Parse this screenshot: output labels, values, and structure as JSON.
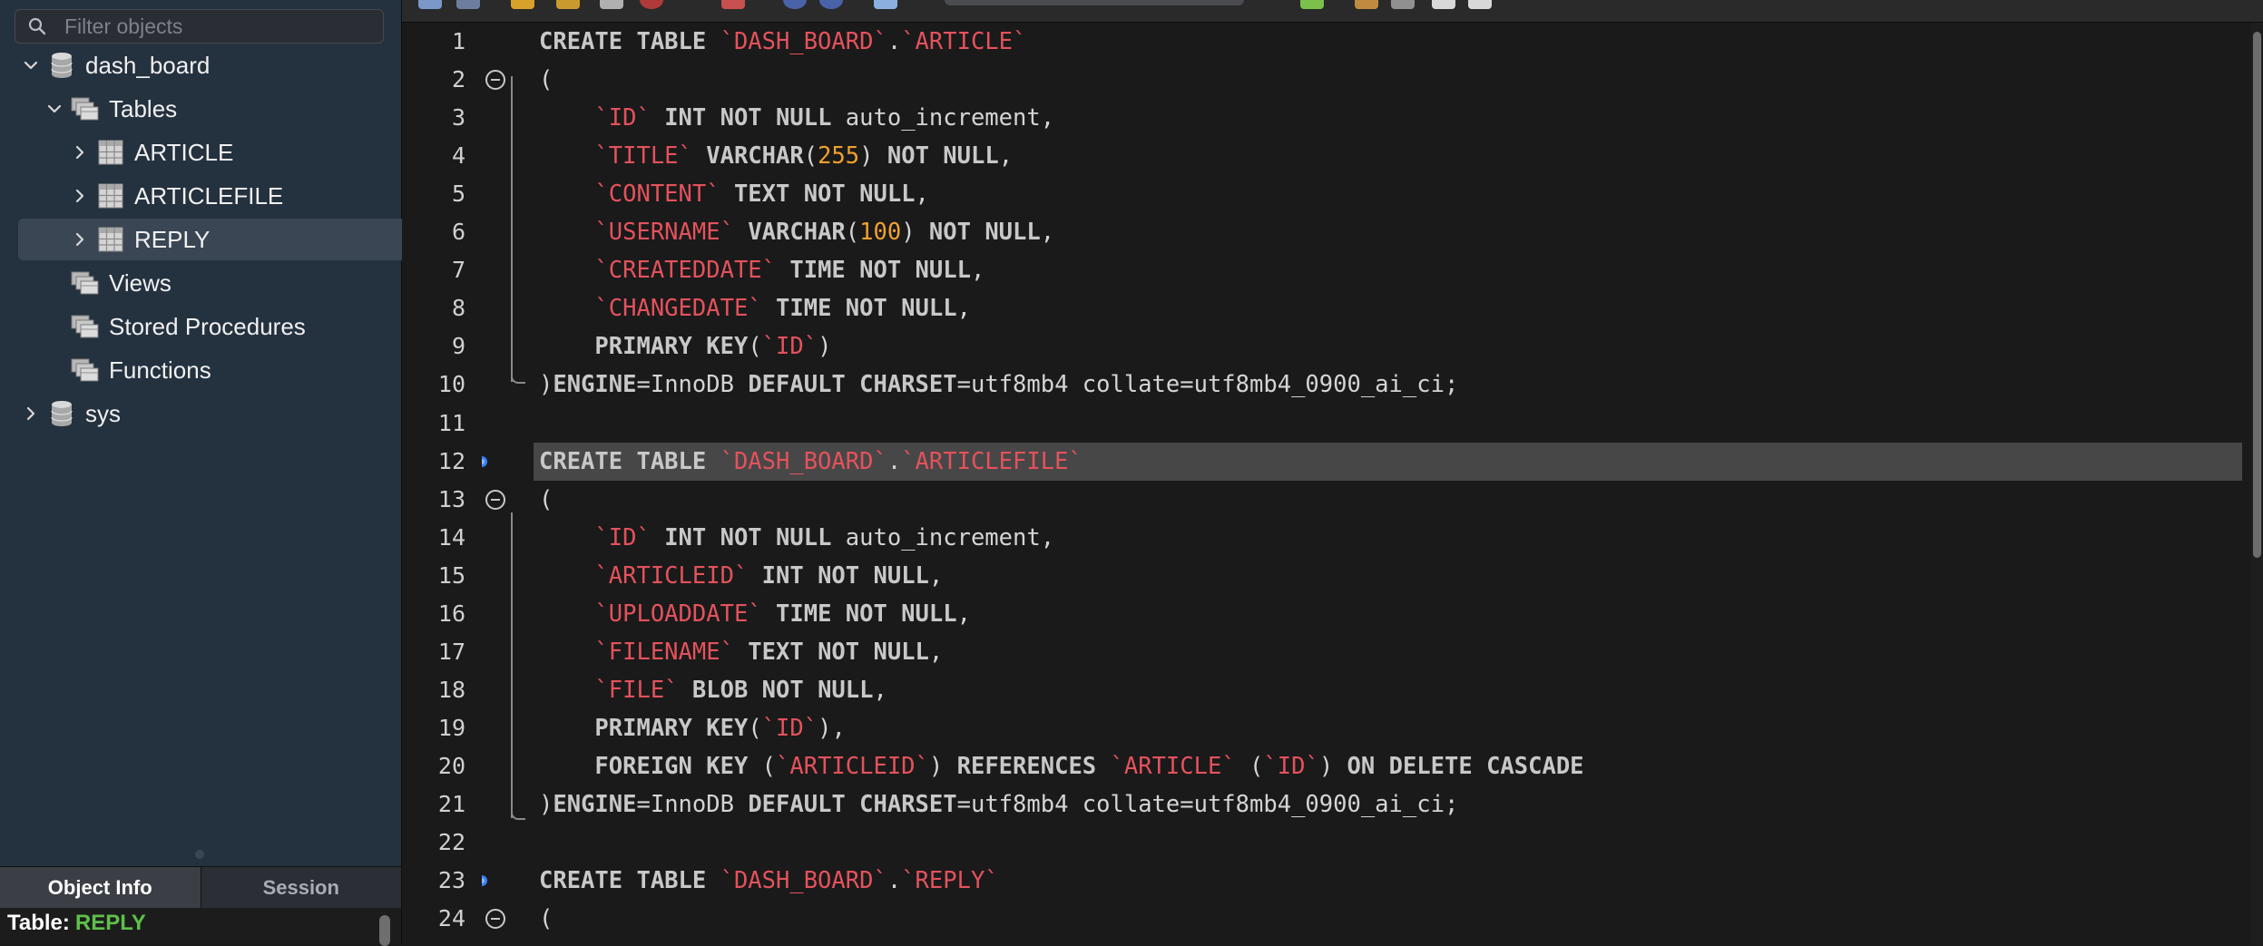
{
  "sidebar": {
    "filter_placeholder": "Filter objects",
    "tree": [
      {
        "label": "dash_board",
        "icon": "database-icon",
        "expanded": true
      },
      {
        "label": "Tables",
        "icon": "folder-icon",
        "expanded": true
      },
      {
        "label": "ARTICLE",
        "icon": "table-icon",
        "expanded": false
      },
      {
        "label": "ARTICLEFILE",
        "icon": "table-icon",
        "expanded": false
      },
      {
        "label": "REPLY",
        "icon": "table-icon",
        "expanded": false,
        "selected": true
      },
      {
        "label": "Views",
        "icon": "folder-icon"
      },
      {
        "label": "Stored Procedures",
        "icon": "folder-icon"
      },
      {
        "label": "Functions",
        "icon": "folder-icon"
      },
      {
        "label": "sys",
        "icon": "database-icon",
        "expanded": false
      }
    ],
    "bottom_tabs": [
      "Object Info",
      "Session"
    ],
    "active_bottom_tab": "Object Info",
    "info_label": "Table:",
    "info_value": "REPLY"
  },
  "editor": {
    "current_line": 12,
    "lines": [
      {
        "n": "1",
        "t": [
          [
            "kw",
            "CREATE TABLE "
          ],
          [
            "id",
            "`DASH_BOARD`"
          ],
          [
            "p",
            "."
          ],
          [
            "id",
            "`ARTICLE`"
          ]
        ]
      },
      {
        "n": "2",
        "t": [
          [
            "p",
            "("
          ]
        ]
      },
      {
        "n": "3",
        "t": [
          [
            "p",
            "    "
          ],
          [
            "id",
            "`ID`"
          ],
          [
            "kw",
            " INT NOT NULL "
          ],
          [
            "p",
            "auto_increment,"
          ]
        ]
      },
      {
        "n": "4",
        "t": [
          [
            "p",
            "    "
          ],
          [
            "id",
            "`TITLE`"
          ],
          [
            "kw",
            " VARCHAR"
          ],
          [
            "p",
            "("
          ],
          [
            "num",
            "255"
          ],
          [
            "p",
            ") "
          ],
          [
            "kw",
            "NOT NULL"
          ],
          [
            "p",
            ","
          ]
        ]
      },
      {
        "n": "5",
        "t": [
          [
            "p",
            "    "
          ],
          [
            "id",
            "`CONTENT`"
          ],
          [
            "kw",
            " TEXT NOT NULL"
          ],
          [
            "p",
            ","
          ]
        ]
      },
      {
        "n": "6",
        "t": [
          [
            "p",
            "    "
          ],
          [
            "id",
            "`USERNAME`"
          ],
          [
            "kw",
            " VARCHAR"
          ],
          [
            "p",
            "("
          ],
          [
            "num",
            "100"
          ],
          [
            "p",
            ") "
          ],
          [
            "kw",
            "NOT NULL"
          ],
          [
            "p",
            ","
          ]
        ]
      },
      {
        "n": "7",
        "t": [
          [
            "p",
            "    "
          ],
          [
            "id",
            "`CREATEDDATE`"
          ],
          [
            "kw",
            " TIME NOT NULL"
          ],
          [
            "p",
            ","
          ]
        ]
      },
      {
        "n": "8",
        "t": [
          [
            "p",
            "    "
          ],
          [
            "id",
            "`CHANGEDATE`"
          ],
          [
            "kw",
            " TIME NOT NULL"
          ],
          [
            "p",
            ","
          ]
        ]
      },
      {
        "n": "9",
        "t": [
          [
            "p",
            "    "
          ],
          [
            "kw",
            "PRIMARY KEY"
          ],
          [
            "p",
            "("
          ],
          [
            "id",
            "`ID`"
          ],
          [
            "p",
            ")"
          ]
        ]
      },
      {
        "n": "10",
        "t": [
          [
            "p",
            ")"
          ],
          [
            "kw",
            "ENGINE"
          ],
          [
            "p",
            "=InnoDB "
          ],
          [
            "kw",
            "DEFAULT CHARSET"
          ],
          [
            "p",
            "=utf8mb4 collate=utf8mb4_0900_ai_ci;"
          ]
        ]
      },
      {
        "n": "11",
        "t": []
      },
      {
        "n": "12",
        "t": [
          [
            "kw",
            "CREATE TABLE "
          ],
          [
            "id",
            "`DASH_BOARD`"
          ],
          [
            "p",
            "."
          ],
          [
            "id",
            "`ARTICLEFILE`"
          ]
        ]
      },
      {
        "n": "13",
        "t": [
          [
            "p",
            "("
          ]
        ]
      },
      {
        "n": "14",
        "t": [
          [
            "p",
            "    "
          ],
          [
            "id",
            "`ID`"
          ],
          [
            "kw",
            " INT NOT NULL "
          ],
          [
            "p",
            "auto_increment,"
          ]
        ]
      },
      {
        "n": "15",
        "t": [
          [
            "p",
            "    "
          ],
          [
            "id",
            "`ARTICLEID`"
          ],
          [
            "kw",
            " INT NOT NULL"
          ],
          [
            "p",
            ","
          ]
        ]
      },
      {
        "n": "16",
        "t": [
          [
            "p",
            "    "
          ],
          [
            "id",
            "`UPLOADDATE`"
          ],
          [
            "kw",
            " TIME NOT NULL"
          ],
          [
            "p",
            ","
          ]
        ]
      },
      {
        "n": "17",
        "t": [
          [
            "p",
            "    "
          ],
          [
            "id",
            "`FILENAME`"
          ],
          [
            "kw",
            " TEXT NOT NULL"
          ],
          [
            "p",
            ","
          ]
        ]
      },
      {
        "n": "18",
        "t": [
          [
            "p",
            "    "
          ],
          [
            "id",
            "`FILE`"
          ],
          [
            "kw",
            " BLOB NOT NULL"
          ],
          [
            "p",
            ","
          ]
        ]
      },
      {
        "n": "19",
        "t": [
          [
            "p",
            "    "
          ],
          [
            "kw",
            "PRIMARY KEY"
          ],
          [
            "p",
            "("
          ],
          [
            "id",
            "`ID`"
          ],
          [
            "p",
            "),"
          ]
        ]
      },
      {
        "n": "20",
        "t": [
          [
            "p",
            "    "
          ],
          [
            "kw",
            "FOREIGN KEY "
          ],
          [
            "p",
            "("
          ],
          [
            "id",
            "`ARTICLEID`"
          ],
          [
            "p",
            ") "
          ],
          [
            "kw",
            "REFERENCES "
          ],
          [
            "id",
            "`ARTICLE`"
          ],
          [
            "p",
            " ("
          ],
          [
            "id",
            "`ID`"
          ],
          [
            "p",
            ") "
          ],
          [
            "kw",
            "ON DELETE CASCADE"
          ]
        ]
      },
      {
        "n": "21",
        "t": [
          [
            "p",
            ")"
          ],
          [
            "kw",
            "ENGINE"
          ],
          [
            "p",
            "=InnoDB "
          ],
          [
            "kw",
            "DEFAULT CHARSET"
          ],
          [
            "p",
            "=utf8mb4 collate=utf8mb4_0900_ai_ci;"
          ]
        ]
      },
      {
        "n": "22",
        "t": []
      },
      {
        "n": "23",
        "t": [
          [
            "kw",
            "CREATE TABLE "
          ],
          [
            "id",
            "`DASH_BOARD`"
          ],
          [
            "p",
            "."
          ],
          [
            "id",
            "`REPLY`"
          ]
        ]
      },
      {
        "n": "24",
        "t": [
          [
            "p",
            "("
          ]
        ]
      }
    ],
    "gutter": {
      "2": "fold-icon",
      "13": "fold-icon",
      "24": "fold-icon",
      "12": "statement-marker-icon",
      "23": "statement-marker-icon"
    }
  },
  "colors": {
    "keyword": "#c8c8c8",
    "identifier": "#e4525c",
    "number": "#f0a030",
    "current_line": "#474747",
    "selected_row": "#3a4654",
    "object_info_value": "#5ec04a"
  }
}
